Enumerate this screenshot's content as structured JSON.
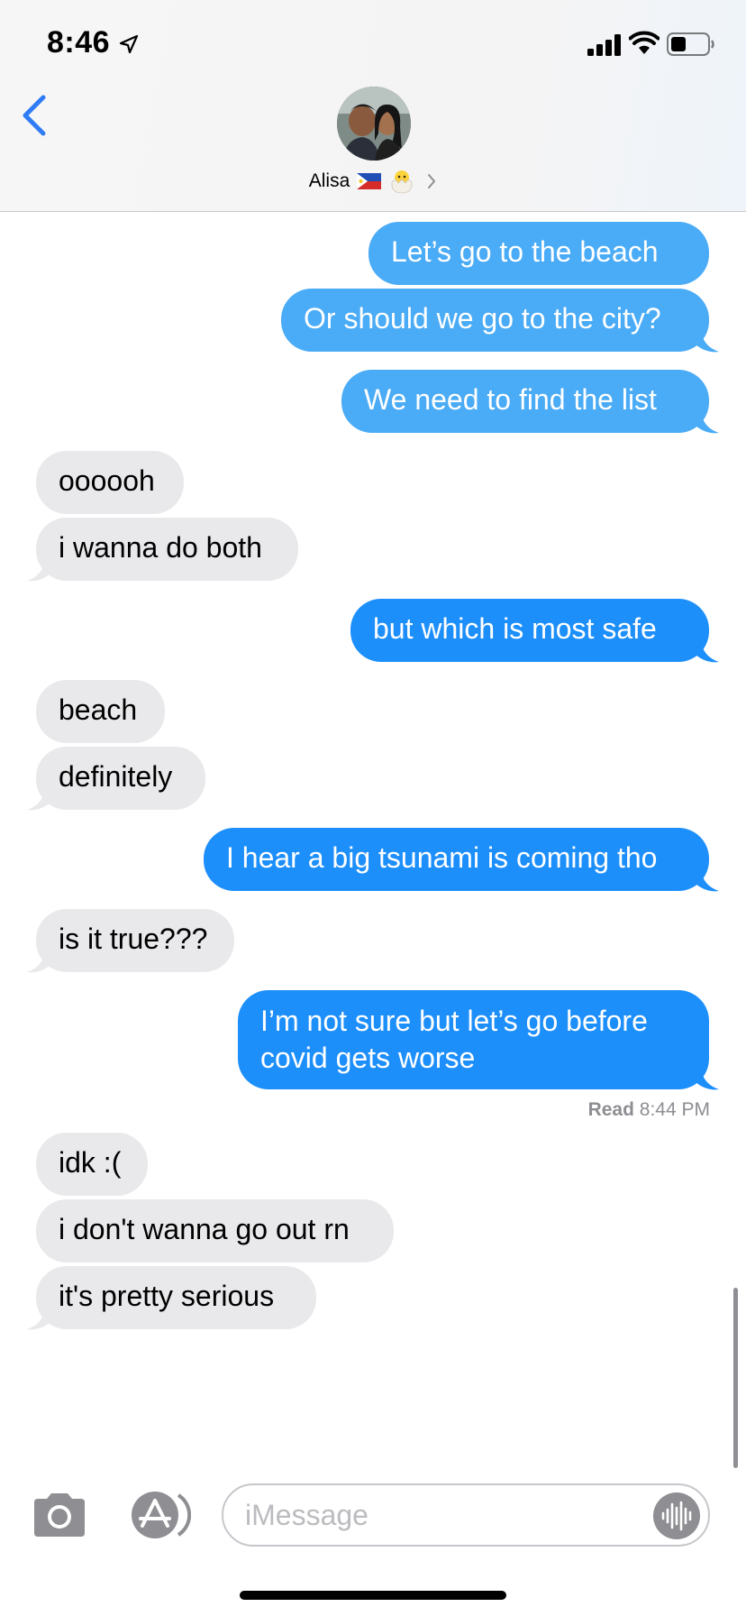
{
  "status_bar": {
    "time": "8:46",
    "icons": [
      "location-arrow-icon",
      "signal-bars-icon",
      "wifi-icon",
      "battery-icon"
    ]
  },
  "header": {
    "back_icon": "chevron-left-icon",
    "contact_name": "Alisa",
    "name_decorations": [
      "philippines-flag-emoji",
      "hatching-chick-emoji"
    ]
  },
  "messages": [
    {
      "direction": "sent",
      "text": "Let’s go to the beach"
    },
    {
      "direction": "sent",
      "text": "Or should we go to the city?"
    },
    {
      "direction": "sent",
      "text": "We need to find the list"
    },
    {
      "direction": "received",
      "text": "oooooh"
    },
    {
      "direction": "received",
      "text": "i wanna do both"
    },
    {
      "direction": "sent",
      "text": "but which is most safe"
    },
    {
      "direction": "received",
      "text": "beach"
    },
    {
      "direction": "received",
      "text": "definitely"
    },
    {
      "direction": "sent",
      "text": "I hear a big tsunami is coming tho"
    },
    {
      "direction": "received",
      "text": "is it true???"
    },
    {
      "direction": "sent",
      "lines": [
        "I’m not sure but let’s go before",
        "covid gets worse"
      ]
    },
    {
      "direction": "received",
      "text": "idk :("
    },
    {
      "direction": "received",
      "text": "i don't wanna go out rn"
    },
    {
      "direction": "received",
      "text": "it's pretty serious"
    }
  ],
  "read_receipt": {
    "label": "Read",
    "time": "8:44 PM"
  },
  "input_bar": {
    "placeholder": "iMessage",
    "left_icons": [
      "camera-icon",
      "app-store-icon"
    ],
    "right_icon": "audio-waveform-icon"
  },
  "colors": {
    "sent_bubble": "#1d8ffb",
    "received_bubble": "#e9e9eb",
    "ios_blue": "#2f7cf6"
  }
}
